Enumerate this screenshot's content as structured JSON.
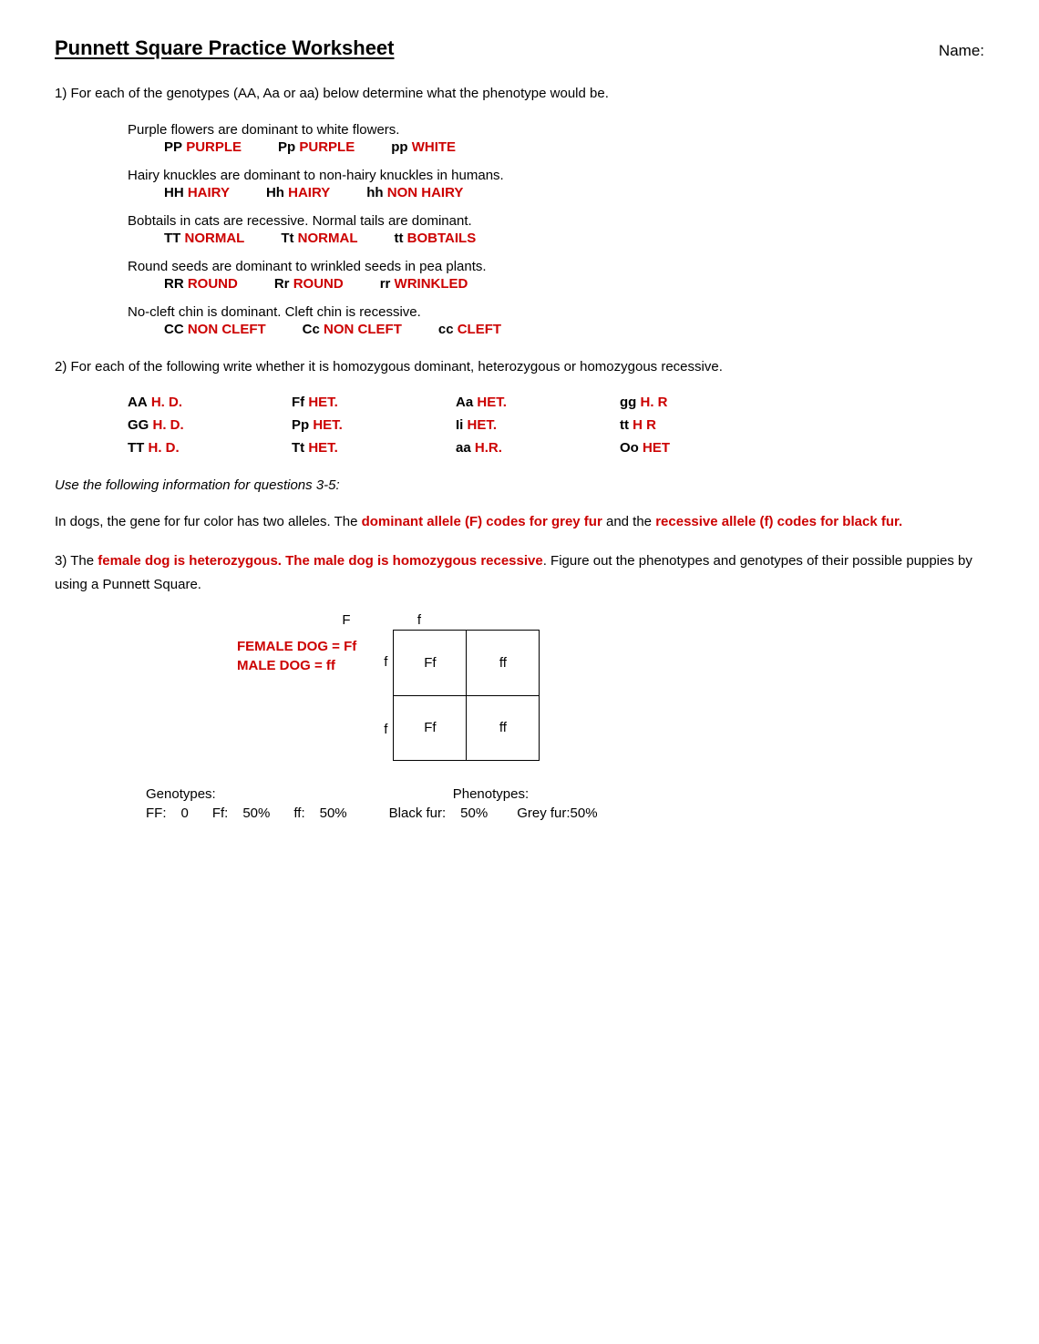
{
  "header": {
    "title": "Punnett Square Practice Worksheet",
    "name_label": "Name:"
  },
  "q1": {
    "intro": "1) For each of the genotypes (AA, Aa or aa) below determine what the phenotype would be.",
    "traits": [
      {
        "description": "Purple flowers are dominant to white flowers.",
        "genotypes": [
          {
            "label": "PP",
            "answer": "PURPLE",
            "color": "red"
          },
          {
            "label": "Pp",
            "answer": "PURPLE",
            "color": "red"
          },
          {
            "label": "pp",
            "answer": "WHITE",
            "color": "red"
          }
        ]
      },
      {
        "description": "Hairy knuckles are dominant to non-hairy knuckles in humans.",
        "genotypes": [
          {
            "label": "HH",
            "answer": "HAIRY",
            "color": "red"
          },
          {
            "label": "Hh",
            "answer": "HAIRY",
            "color": "red"
          },
          {
            "label": "hh",
            "answer": "NON HAIRY",
            "color": "red"
          }
        ]
      },
      {
        "description": "Bobtails in cats are recessive. Normal tails are dominant.",
        "genotypes": [
          {
            "label": "TT",
            "answer": "NORMAL",
            "color": "red"
          },
          {
            "label": "Tt",
            "answer": "NORMAL",
            "color": "red"
          },
          {
            "label": "tt",
            "answer": "BOBTAILS",
            "color": "red"
          }
        ]
      },
      {
        "description": "Round seeds are dominant to wrinkled seeds in pea plants.",
        "genotypes": [
          {
            "label": "RR",
            "answer": "ROUND",
            "color": "red"
          },
          {
            "label": "Rr",
            "answer": "ROUND",
            "color": "red"
          },
          {
            "label": "rr",
            "answer": "WRINKLED",
            "color": "red"
          }
        ]
      },
      {
        "description": "No-cleft chin is dominant. Cleft chin is recessive.",
        "genotypes": [
          {
            "label": "CC",
            "answer": "NON CLEFT",
            "color": "red"
          },
          {
            "label": "Cc",
            "answer": "NON CLEFT",
            "color": "red"
          },
          {
            "label": "cc",
            "answer": "CLEFT",
            "color": "red"
          }
        ]
      }
    ]
  },
  "q2": {
    "intro": "2) For each of the following write whether it is homozygous dominant, heterozygous or homozygous recessive.",
    "grid": [
      [
        {
          "label": "AA",
          "answer": "H. D.",
          "color": "red"
        },
        {
          "label": "Ff",
          "answer": "HET.",
          "color": "red"
        },
        {
          "label": "Aa",
          "answer": "HET.",
          "color": "red"
        },
        {
          "label": "gg",
          "answer": "H. R",
          "color": "red"
        }
      ],
      [
        {
          "label": "GG",
          "answer": "H. D.",
          "color": "red"
        },
        {
          "label": "Pp",
          "answer": "HET.",
          "color": "red"
        },
        {
          "label": "Ii",
          "answer": "HET.",
          "color": "red"
        },
        {
          "label": "tt",
          "answer": "H R",
          "color": "red"
        }
      ],
      [
        {
          "label": "TT",
          "answer": "H. D.",
          "color": "red"
        },
        {
          "label": "Tt",
          "answer": "HET.",
          "color": "red"
        },
        {
          "label": "aa",
          "answer": "H.R.",
          "color": "red"
        },
        {
          "label": "Oo",
          "answer": "HET",
          "color": "red"
        }
      ]
    ]
  },
  "q3_intro": "Use the following information for questions 3-5:",
  "q3_info1": "In dogs, the gene for fur color has two alleles.  The ",
  "q3_info1_red1": "dominant allele (F) codes for grey fur",
  "q3_info1_mid": " and the ",
  "q3_info1_red2": "recessive allele (f) codes for black fur.",
  "q3_question": "3) The ",
  "q3_question_red": "female dog is heterozygous. The male dog is homozygous recessive",
  "q3_question_end": ". Figure out the phenotypes and genotypes of their possible puppies by using a Punnett Square.",
  "punnett": {
    "col_headers": [
      "F",
      "f"
    ],
    "row_headers": [
      "f",
      "f"
    ],
    "cells": [
      [
        "Ff",
        "ff"
      ],
      [
        "Ff",
        "ff"
      ]
    ]
  },
  "female_dog_label1": "FEMALE DOG = Ff",
  "female_dog_label2": "MALE DOG = ff",
  "genotypes": {
    "label": "Genotypes:",
    "ff_label": "FF:",
    "ff_val": "0",
    "Ff_label": "Ff:",
    "Ff_val": "50%",
    "ff2_label": "ff:",
    "ff2_val": "50%"
  },
  "phenotypes": {
    "label": "Phenotypes:",
    "black_label": "Black fur:",
    "black_val": "50%",
    "grey_label": "Grey fur:50%"
  }
}
